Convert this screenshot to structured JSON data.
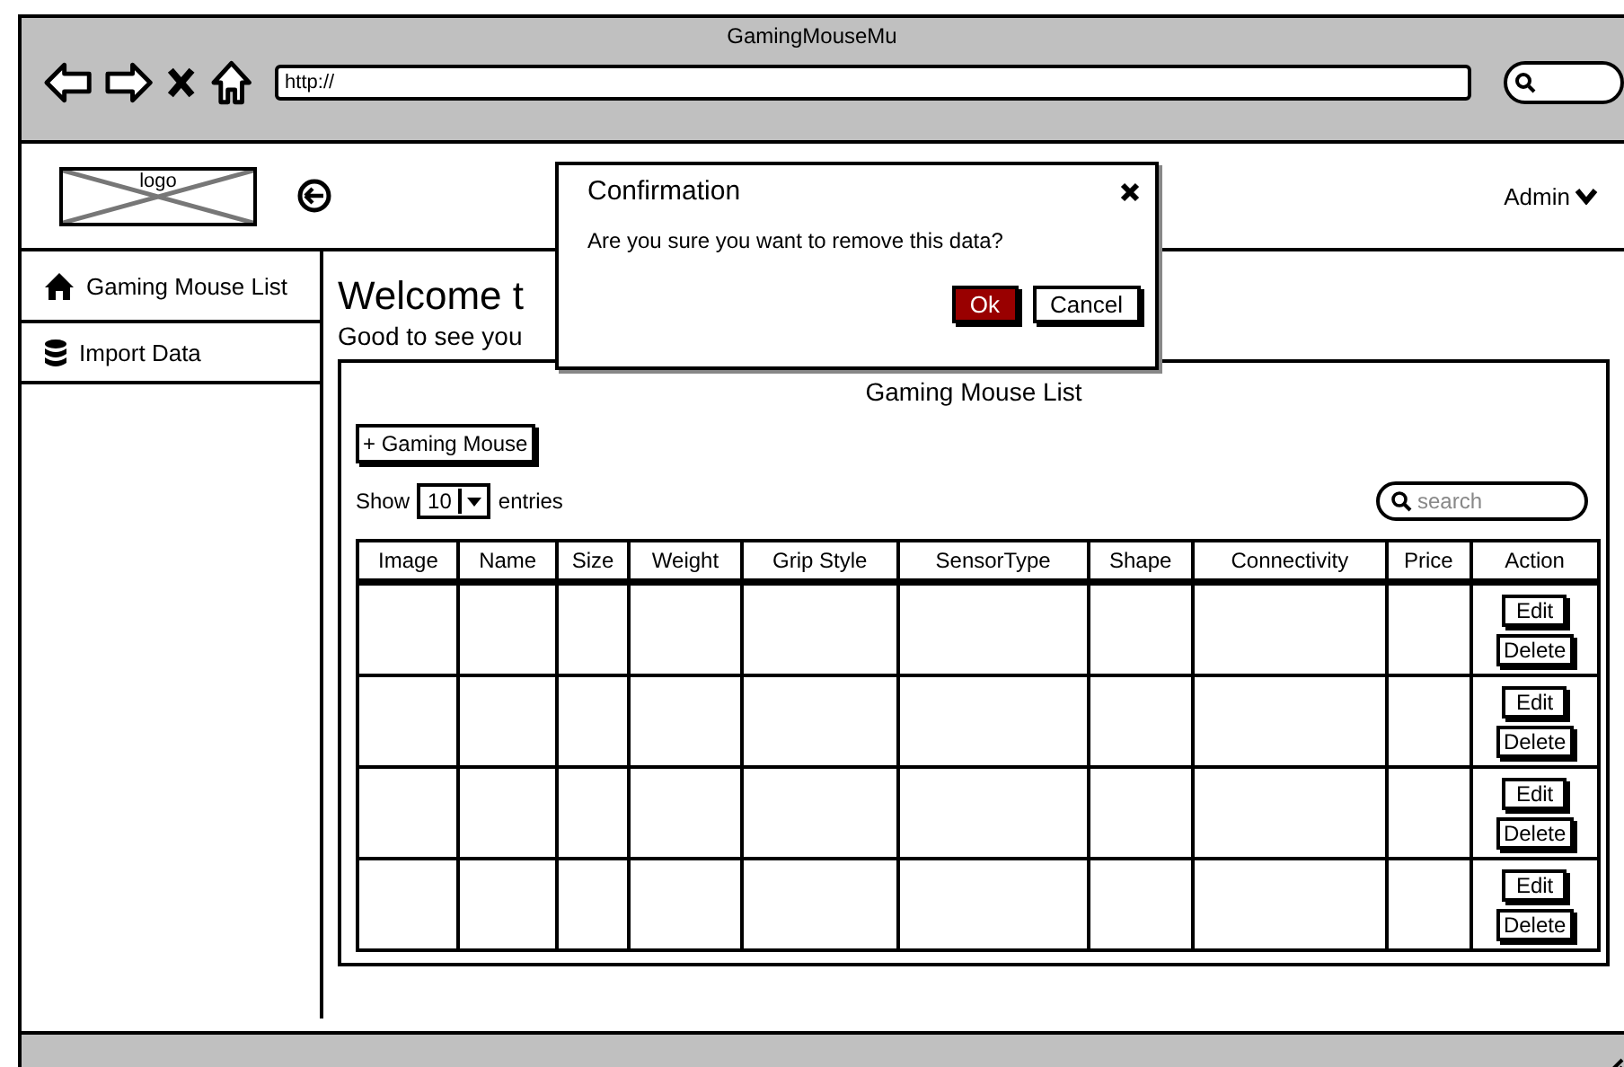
{
  "window": {
    "title": "GamingMouseMu",
    "address": "http://"
  },
  "header": {
    "logo": "logo",
    "user": "Admin"
  },
  "sidebar": {
    "items": [
      {
        "label": "Gaming Mouse List",
        "kind": "home"
      },
      {
        "label": "Import Data",
        "kind": "database"
      }
    ]
  },
  "welcome": {
    "title": "Welcome t",
    "subtitle": "Good to see you"
  },
  "panel": {
    "title": "Gaming Mouse List",
    "add_button": "+ Gaming Mouse",
    "show_label": "Show",
    "page_size": "10",
    "entries_label": "entries",
    "search": {
      "placeholder": "search"
    }
  },
  "table": {
    "columns": [
      "Image",
      "Name",
      "Size",
      "Weight",
      "Grip Style",
      "SensorType",
      "Shape",
      "Connectivity",
      "Price",
      "Action"
    ],
    "rows": [
      {
        "edit": "Edit",
        "delete": "Delete"
      },
      {
        "edit": "Edit",
        "delete": "Delete"
      },
      {
        "edit": "Edit",
        "delete": "Delete"
      },
      {
        "edit": "Edit",
        "delete": "Delete"
      }
    ]
  },
  "dialog": {
    "title": "Confirmation",
    "message": "Are you sure you want to remove this data?",
    "buttons": [
      {
        "label": "Ok",
        "kind": "primary"
      },
      {
        "label": "Cancel",
        "kind": "secondary"
      }
    ]
  }
}
